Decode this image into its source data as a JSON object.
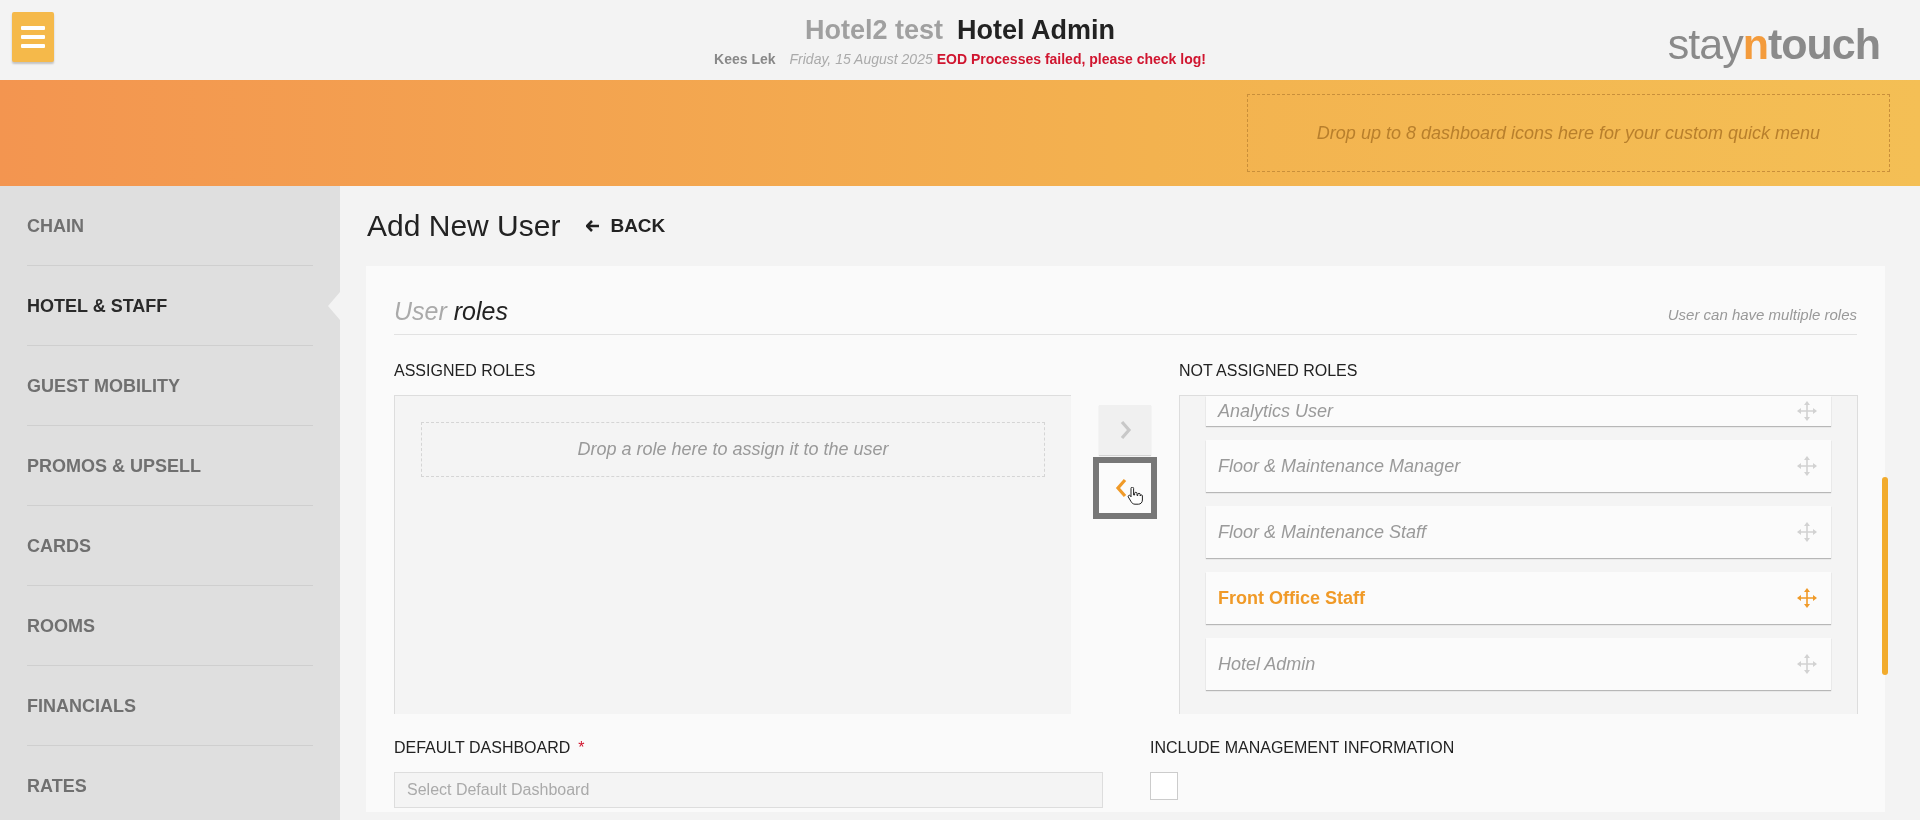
{
  "header": {
    "hotel_name": "Hotel2 test",
    "role": "Hotel Admin",
    "user": "Kees Lek",
    "date": "Friday, 15 August 2025",
    "alert": "EOD Processes failed, please check log!",
    "logo": [
      {
        "text": "stay",
        "kind": "light"
      },
      {
        "text": "n",
        "kind": "accent"
      },
      {
        "text": "touch",
        "kind": "bold"
      }
    ]
  },
  "quick_menu": {
    "dropzone": "Drop up to 8 dashboard icons here for your custom quick menu"
  },
  "sidebar": {
    "items": [
      {
        "label": "CHAIN",
        "selected": false
      },
      {
        "label": "HOTEL & STAFF",
        "selected": true
      },
      {
        "label": "GUEST MOBILITY",
        "selected": false
      },
      {
        "label": "PROMOS & UPSELL",
        "selected": false
      },
      {
        "label": "CARDS",
        "selected": false
      },
      {
        "label": "ROOMS",
        "selected": false
      },
      {
        "label": "FINANCIALS",
        "selected": false
      },
      {
        "label": "RATES",
        "selected": false
      }
    ]
  },
  "page": {
    "title": "Add New User",
    "back": "BACK"
  },
  "section": {
    "title_prefix": "User",
    "title": "roles",
    "hint": "User can have multiple roles"
  },
  "assigned": {
    "label": "ASSIGNED ROLES",
    "dropzone": "Drop a role here to assign it to the user"
  },
  "transfer_buttons": [
    {
      "kind": "right",
      "disabled": true,
      "focused": false
    },
    {
      "kind": "left",
      "disabled": false,
      "focused": true
    }
  ],
  "not_assigned": {
    "label": "NOT ASSIGNED ROLES",
    "items": [
      {
        "label": "Analytics User",
        "selected": false
      },
      {
        "label": "Floor & Maintenance Manager",
        "selected": false
      },
      {
        "label": "Floor & Maintenance Staff",
        "selected": false
      },
      {
        "label": "Front Office Staff",
        "selected": true
      },
      {
        "label": "Hotel Admin",
        "selected": false
      }
    ]
  },
  "default_dashboard": {
    "label": "DEFAULT DASHBOARD",
    "required_mark": "*",
    "placeholder": "Select Default Dashboard"
  },
  "management_info": {
    "label": "INCLUDE MANAGEMENT INFORMATION",
    "checked": false
  }
}
